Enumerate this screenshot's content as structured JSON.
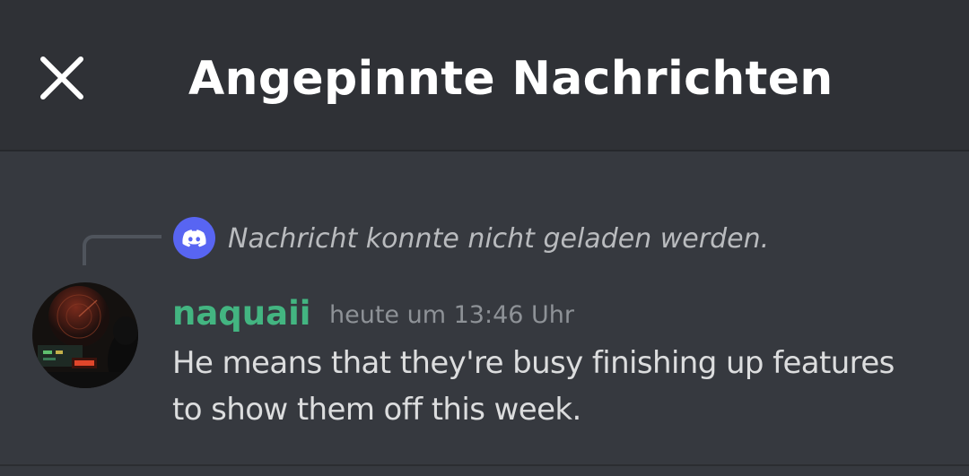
{
  "header": {
    "title": "Angepinnte Nachrichten",
    "close_icon": "close-icon"
  },
  "pinned_message": {
    "reply": {
      "icon": "discord-logo-icon",
      "text": "Nachricht konnte nicht geladen werden."
    },
    "author": {
      "name": "naquaii",
      "name_color": "#43b581",
      "avatar_icon": "avatar-image"
    },
    "timestamp": "heute um 13:46 Uhr",
    "content_lines": [
      "He means that they're busy finishing up features",
      "to show them off this week."
    ]
  },
  "colors": {
    "header_bg": "#2f3136",
    "body_bg": "#36393f",
    "blurple": "#5865f2",
    "text": "#dcddde",
    "muted": "#8e9297"
  }
}
